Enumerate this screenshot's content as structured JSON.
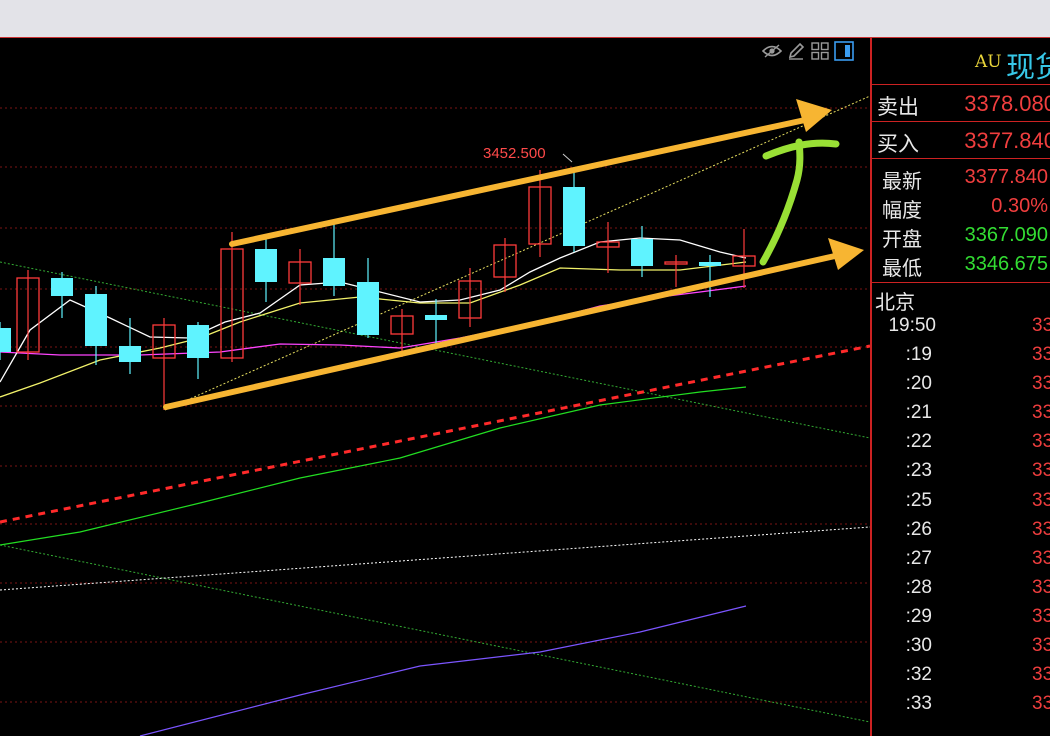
{
  "chart_data": {
    "type": "candlestick",
    "annotations": {
      "high_label": "3452.500"
    },
    "colors": {
      "up": "#ff3b3b",
      "down": "#5ff3ff",
      "ma5": "#ffffff",
      "ma10": "#f2f26a",
      "ma20": "#ff44ff",
      "ma60": "#22dd22",
      "ma120": "#7b55ff",
      "channel_arrow": "#f7b532",
      "drawn_arrow": "#99e035",
      "trendline": "#ff2a2a"
    }
  },
  "toolbar": {
    "icons": [
      "eye-icon",
      "pencil-icon",
      "grid-icon",
      "panel-toggle-icon"
    ]
  },
  "quote": {
    "code": "AU",
    "name": "现货",
    "sell_label": "卖出",
    "sell": "3378.080",
    "buy_label": "买入",
    "buy": "3377.840",
    "stats": [
      {
        "label": "最新",
        "value": "3377.840",
        "color": "#f03e3e"
      },
      {
        "label": "幅度",
        "value": "0.30%",
        "color": "#f03e3e"
      },
      {
        "label": "开盘",
        "value": "3367.090",
        "color": "#33dd33"
      },
      {
        "label": "最低",
        "value": "3346.675",
        "color": "#33dd33"
      }
    ],
    "city": "北京",
    "ticks": [
      {
        "time": "19:50",
        "price": "33"
      },
      {
        "time": ":19",
        "price": "33"
      },
      {
        "time": ":20",
        "price": "33"
      },
      {
        "time": ":21",
        "price": "33"
      },
      {
        "time": ":22",
        "price": "33"
      },
      {
        "time": ":23",
        "price": "33"
      },
      {
        "time": ":25",
        "price": "33"
      },
      {
        "time": ":26",
        "price": "33"
      },
      {
        "time": ":27",
        "price": "33"
      },
      {
        "time": ":28",
        "price": "33"
      },
      {
        "time": ":29",
        "price": "33"
      },
      {
        "time": ":30",
        "price": "33"
      },
      {
        "time": ":32",
        "price": "33"
      },
      {
        "time": ":33",
        "price": "33"
      }
    ]
  }
}
